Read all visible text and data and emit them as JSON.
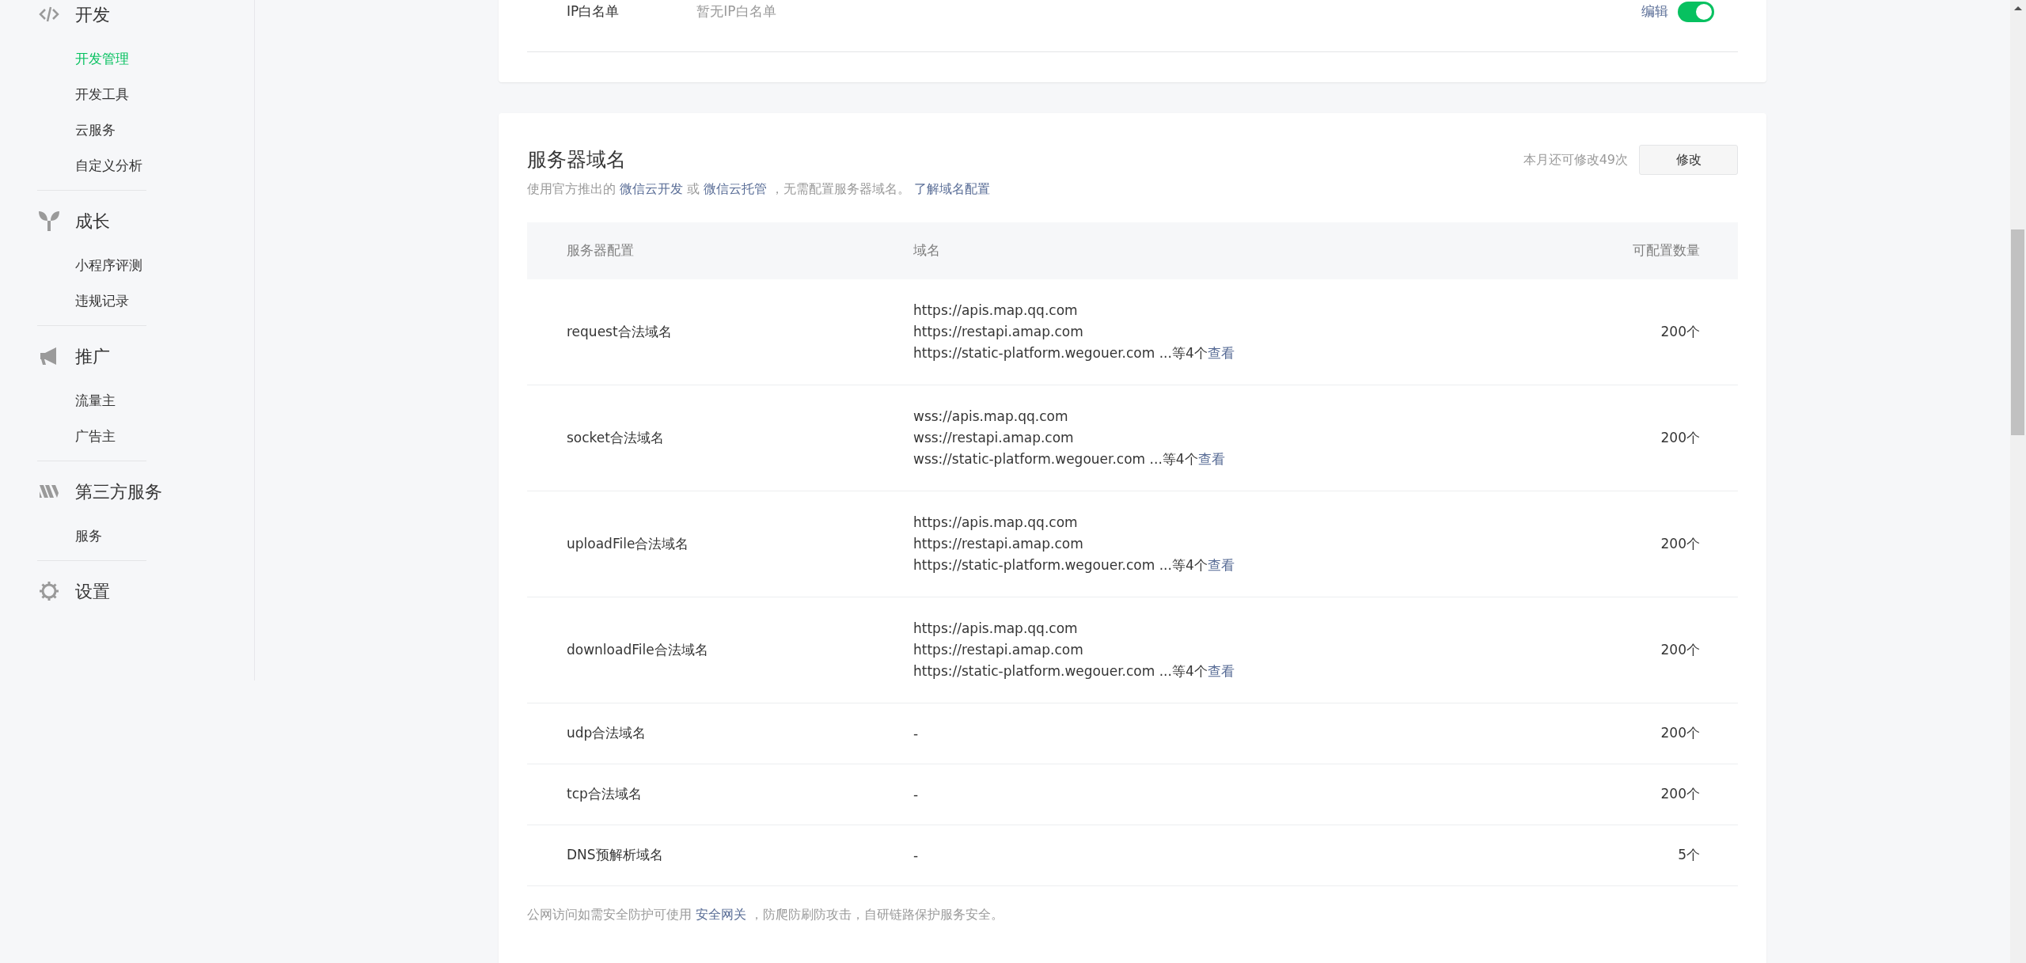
{
  "sidebar": {
    "groups": [
      {
        "title": "开发",
        "items": [
          {
            "label": "开发管理",
            "selected": true
          },
          {
            "label": "开发工具",
            "selected": false
          },
          {
            "label": "云服务",
            "selected": false
          },
          {
            "label": "自定义分析",
            "selected": false
          }
        ]
      },
      {
        "title": "成长",
        "items": [
          {
            "label": "小程序评测",
            "selected": false
          },
          {
            "label": "违规记录",
            "selected": false
          }
        ]
      },
      {
        "title": "推广",
        "items": [
          {
            "label": "流量主",
            "selected": false
          },
          {
            "label": "广告主",
            "selected": false
          }
        ]
      },
      {
        "title": "第三方服务",
        "items": [
          {
            "label": "服务",
            "selected": false
          }
        ]
      },
      {
        "title": "设置"
      }
    ]
  },
  "ip_whitelist": {
    "label": "IP白名单",
    "value": "暂无IP白名单",
    "edit_link": "编辑",
    "on": true
  },
  "server_domains": {
    "title": "服务器域名",
    "description": [
      {
        "kind": "text",
        "text": "使用官方推出的 "
      },
      {
        "kind": "link",
        "text": "微信云开发"
      },
      {
        "kind": "text",
        "text": " 或 "
      },
      {
        "kind": "link",
        "text": "微信云托管"
      },
      {
        "kind": "text",
        "text": " ，无需配置服务器域名。 "
      },
      {
        "kind": "link",
        "text": "了解域名配置"
      }
    ],
    "remaining": "本月还可修改49次",
    "modify_button": "修改",
    "table": {
      "columns": [
        "服务器配置",
        "域名",
        "可配置数量"
      ],
      "rows": [
        {
          "name": "request合法域名",
          "domains": [
            "https://apis.map.qq.com",
            "https://restapi.amap.com",
            "https://static-platform.wegouer.com ...等4个"
          ],
          "view_link": "查看",
          "count": "200个"
        },
        {
          "name": "socket合法域名",
          "domains": [
            "wss://apis.map.qq.com",
            "wss://restapi.amap.com",
            "wss://static-platform.wegouer.com ...等4个"
          ],
          "view_link": "查看",
          "count": "200个"
        },
        {
          "name": "uploadFile合法域名",
          "domains": [
            "https://apis.map.qq.com",
            "https://restapi.amap.com",
            "https://static-platform.wegouer.com ...等4个"
          ],
          "view_link": "查看",
          "count": "200个"
        },
        {
          "name": "downloadFile合法域名",
          "domains": [
            "https://apis.map.qq.com",
            "https://restapi.amap.com",
            "https://static-platform.wegouer.com ...等4个"
          ],
          "view_link": "查看",
          "count": "200个"
        },
        {
          "name": "udp合法域名",
          "domains": [
            "-"
          ],
          "count": "200个"
        },
        {
          "name": "tcp合法域名",
          "domains": [
            "-"
          ],
          "count": "200个"
        },
        {
          "name": "DNS预解析域名",
          "domains": [
            "-"
          ],
          "count": "5个"
        }
      ]
    },
    "footer": [
      {
        "kind": "text",
        "text": "公网访问如需安全防护可使用 "
      },
      {
        "kind": "link",
        "text": "安全网关"
      },
      {
        "kind": "text",
        "text": " ，防爬防刷防攻击，自研链路保护服务安全。"
      }
    ]
  }
}
